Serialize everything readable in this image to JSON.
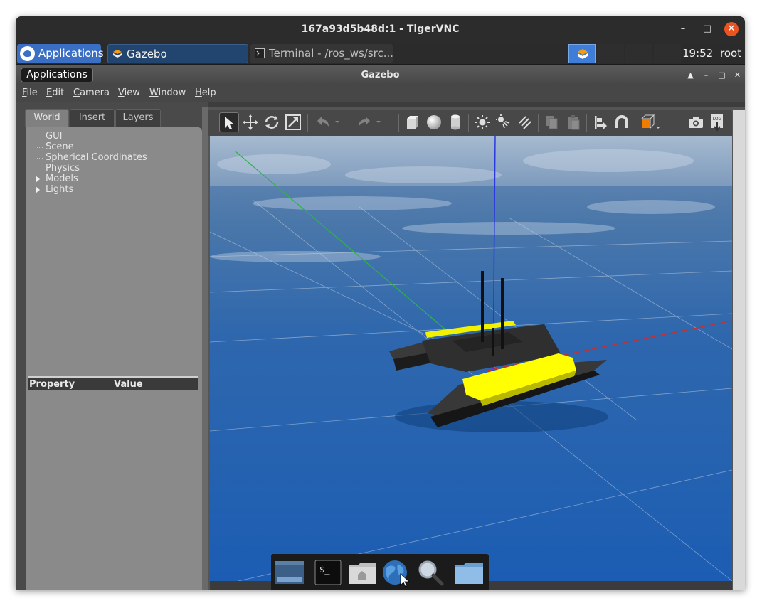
{
  "vnc_window": {
    "title": "167a93d5b48d:1 - TigerVNC",
    "controls": [
      "minimize-icon",
      "maximize-icon",
      "close-icon"
    ]
  },
  "taskbar": {
    "applications_label": "Applications",
    "tasks": [
      {
        "label": "Gazebo",
        "icon": "gazebo-icon",
        "active": true
      },
      {
        "label": "Terminal - /ros_ws/src...",
        "icon": "terminal-icon",
        "active": false
      }
    ],
    "clock": "19:52",
    "user": "root"
  },
  "gazebo_window": {
    "title": "Gazebo",
    "applications_tooltip": "Applications"
  },
  "menubar": {
    "items": [
      {
        "label": "File",
        "mnemonic": "F",
        "rest": "ile"
      },
      {
        "label": "Edit",
        "mnemonic": "E",
        "rest": "dit"
      },
      {
        "label": "Camera",
        "mnemonic": "C",
        "rest": "amera"
      },
      {
        "label": "View",
        "mnemonic": "V",
        "rest": "iew"
      },
      {
        "label": "Window",
        "mnemonic": "W",
        "rest": "indow"
      },
      {
        "label": "Help",
        "mnemonic": "H",
        "rest": "elp"
      }
    ]
  },
  "left_panel": {
    "tabs": [
      {
        "label": "World",
        "active": true
      },
      {
        "label": "Insert",
        "active": false
      },
      {
        "label": "Layers",
        "active": false
      }
    ],
    "tree": [
      {
        "label": "GUI",
        "expandable": false
      },
      {
        "label": "Scene",
        "expandable": false
      },
      {
        "label": "Spherical Coordinates",
        "expandable": false
      },
      {
        "label": "Physics",
        "expandable": false
      },
      {
        "label": "Models",
        "expandable": true
      },
      {
        "label": "Lights",
        "expandable": true
      }
    ],
    "property_header": {
      "property": "Property",
      "value": "Value"
    }
  },
  "toolbar": {
    "tools": [
      "select-icon",
      "translate-icon",
      "rotate-icon",
      "scale-icon",
      "undo-icon",
      "redo-icon",
      "box-icon",
      "sphere-icon",
      "cylinder-icon",
      "point-light-icon",
      "spot-light-icon",
      "directional-light-icon",
      "copy-icon",
      "paste-icon",
      "align-icon",
      "snap-icon",
      "view-angle-icon",
      "screenshot-icon",
      "log-icon"
    ],
    "log_text": "LOG"
  },
  "scene": {
    "description_colors": {
      "sky": "#9fb3c9",
      "water": "#1f5fa8",
      "hull": "#2b2b2b",
      "deck": "#ffff00",
      "x_axis": "#cc2222",
      "y_axis": "#22aa22",
      "z_axis": "#2222dd"
    }
  },
  "dock": {
    "items": [
      "desktop-icon",
      "terminal-icon",
      "home-folder-icon",
      "web-browser-icon",
      "search-icon",
      "folder-icon"
    ],
    "terminal_glyph": "$_"
  }
}
